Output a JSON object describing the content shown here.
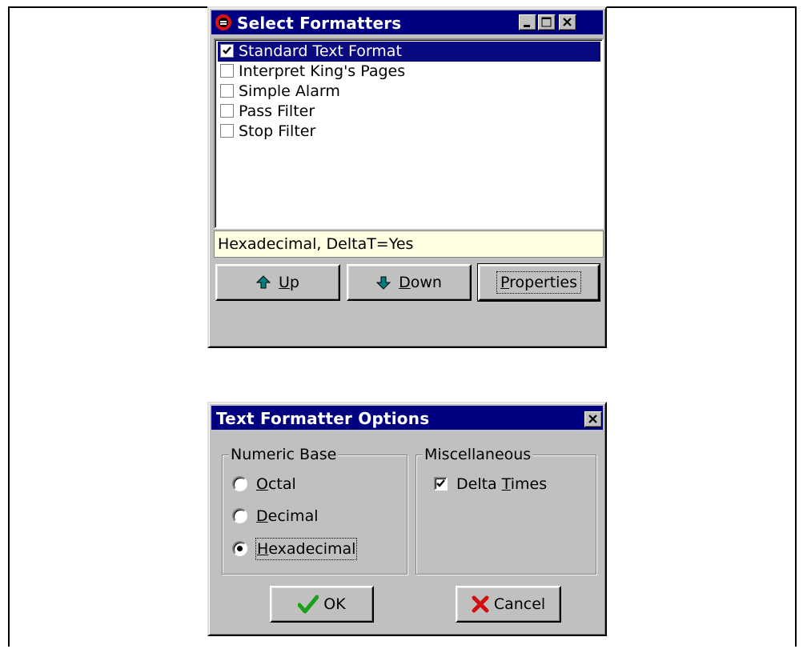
{
  "select_formatters": {
    "title": "Select Formatters",
    "items": [
      {
        "label": "Standard Text Format",
        "checked": true,
        "selected": true
      },
      {
        "label": "Interpret King's Pages",
        "checked": false,
        "selected": false
      },
      {
        "label": "Simple Alarm",
        "checked": false,
        "selected": false
      },
      {
        "label": "Pass Filter",
        "checked": false,
        "selected": false
      },
      {
        "label": "Stop Filter",
        "checked": false,
        "selected": false
      }
    ],
    "status": "Hexadecimal, DeltaT=Yes",
    "buttons": {
      "up": {
        "mnemonic": "U",
        "rest": "p"
      },
      "down": {
        "mnemonic": "D",
        "rest": "own"
      },
      "properties": {
        "mnemonic": "P",
        "rest": "roperties"
      }
    }
  },
  "text_formatter_options": {
    "title": "Text Formatter Options",
    "numeric_base": {
      "label": "Numeric Base",
      "options": [
        {
          "mnemonic": "O",
          "rest": "ctal",
          "selected": false
        },
        {
          "mnemonic": "D",
          "rest": "ecimal",
          "selected": false
        },
        {
          "mnemonic": "H",
          "rest": "exadecimal",
          "selected": true
        }
      ]
    },
    "misc": {
      "label": "Miscellaneous",
      "delta_times": {
        "before": "Delta ",
        "mnemonic": "T",
        "rest": "imes",
        "checked": true
      }
    },
    "ok_label": "OK",
    "cancel_label": "Cancel"
  },
  "colors": {
    "titlebar": "#000080",
    "face": "#c0c0c0",
    "selection": "#0a0a80",
    "tooltip": "#ffffe1",
    "ok_check": "#1aa01a",
    "cancel_x": "#d01010",
    "arrow": "#008080"
  }
}
